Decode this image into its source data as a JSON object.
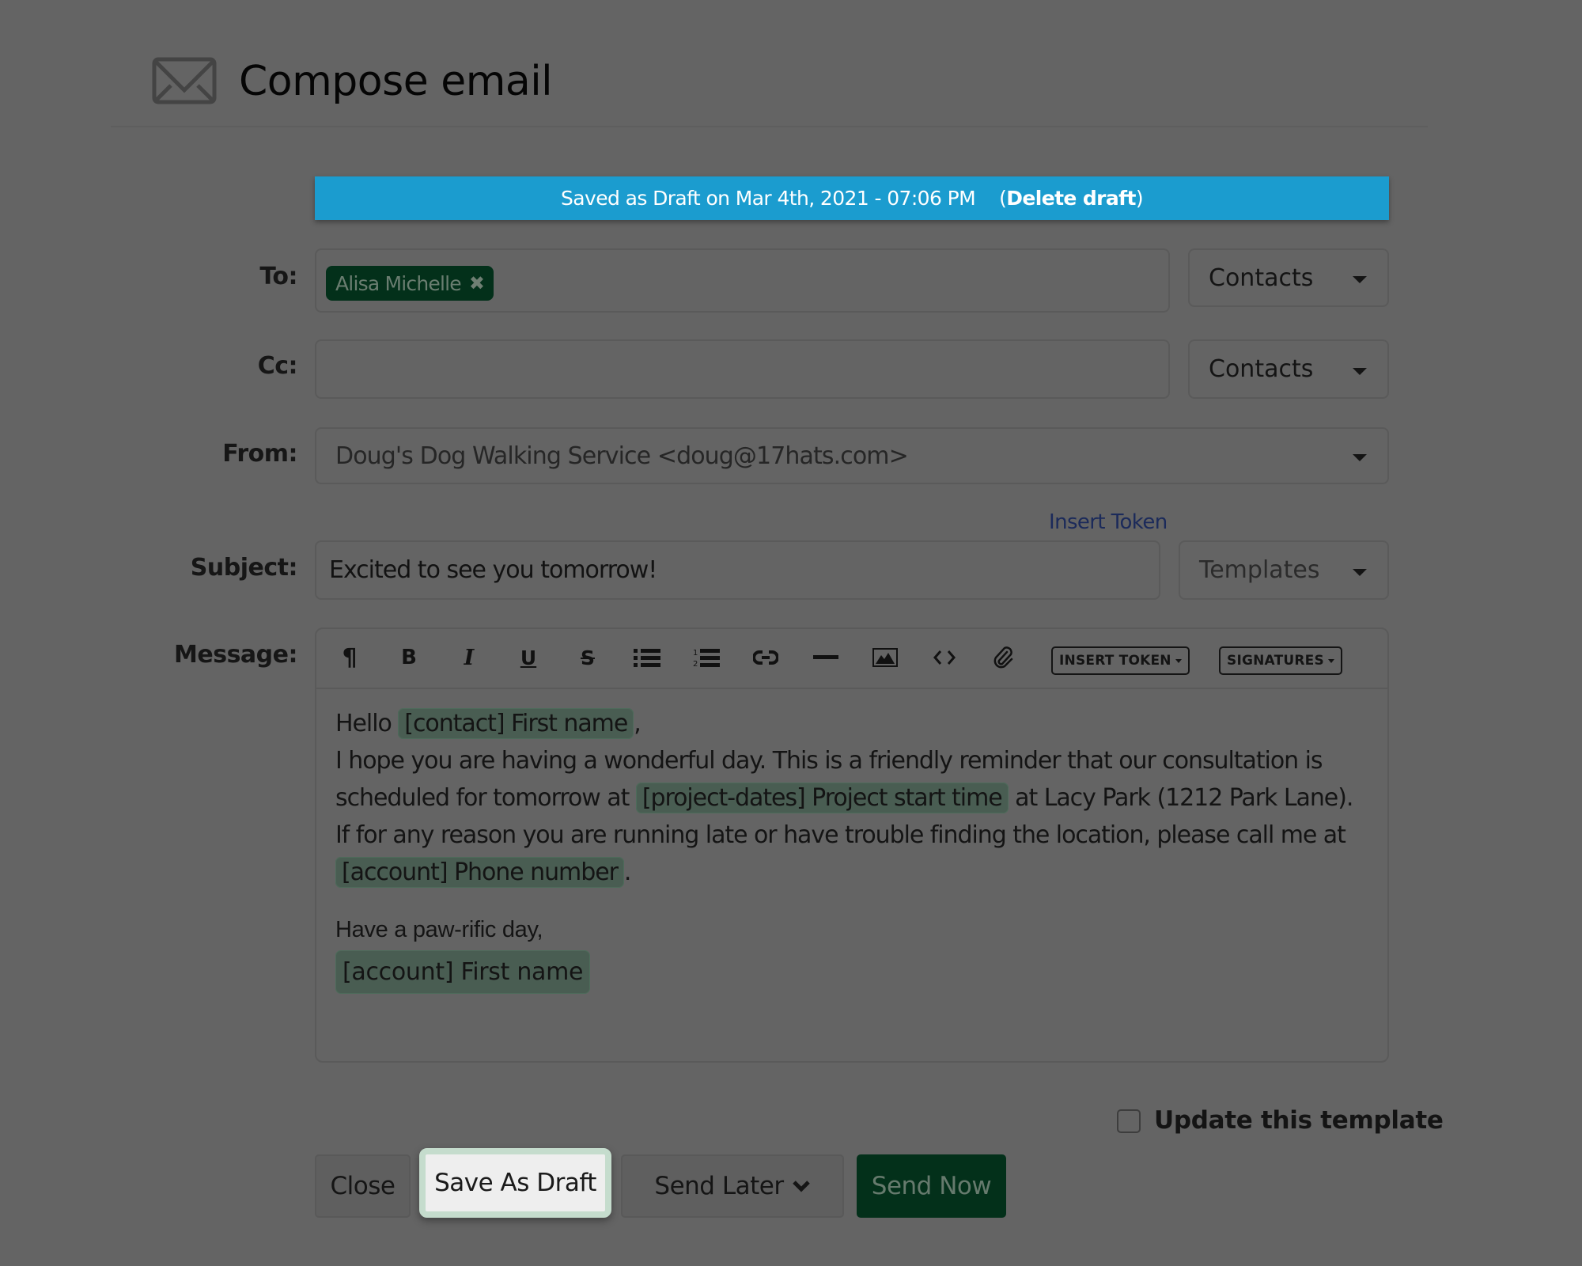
{
  "header": {
    "title": "Compose email",
    "icon": "envelope-icon"
  },
  "banner": {
    "text": "Saved as Draft on Mar 4th, 2021 - 07:06 PM",
    "open_paren": "(",
    "delete_link": "Delete draft",
    "close_paren": ")",
    "color": "#1b9ccf"
  },
  "to": {
    "label": "To:",
    "recipients": [
      {
        "name": "Alisa Michelle",
        "remove_icon": "close-icon"
      }
    ],
    "dropdown": "Contacts"
  },
  "cc": {
    "label": "Cc:",
    "value": "",
    "dropdown": "Contacts"
  },
  "from": {
    "label": "From:",
    "value": "Doug's Dog Walking Service <doug@17hats.com>"
  },
  "subject": {
    "label": "Subject:",
    "insert_token_link": "Insert Token",
    "value": "Excited to see you tomorrow!",
    "dropdown": "Templates"
  },
  "message": {
    "label": "Message:",
    "toolbar": {
      "buttons": [
        {
          "name": "paragraph",
          "icon": "paragraph-icon",
          "glyph": "¶"
        },
        {
          "name": "bold",
          "icon": "bold-icon",
          "glyph": "B"
        },
        {
          "name": "italic",
          "icon": "italic-icon",
          "glyph": "I"
        },
        {
          "name": "underline",
          "icon": "underline-icon",
          "glyph": "U"
        },
        {
          "name": "strikethrough",
          "icon": "strikethrough-icon",
          "glyph": "S"
        },
        {
          "name": "bullet-list",
          "icon": "bullet-list-icon"
        },
        {
          "name": "numbered-list",
          "icon": "numbered-list-icon"
        },
        {
          "name": "link",
          "icon": "link-icon"
        },
        {
          "name": "horizontal-rule",
          "icon": "horizontal-rule-icon"
        },
        {
          "name": "image",
          "icon": "image-icon"
        },
        {
          "name": "code",
          "icon": "code-icon"
        },
        {
          "name": "attachment",
          "icon": "paperclip-icon"
        }
      ],
      "insert_token": "INSERT TOKEN",
      "signatures": "SIGNATURES"
    },
    "body": {
      "greeting": "Hello",
      "token_contact_first_name": "[contact] First name",
      "comma": ",",
      "line2a": "I hope you are having a wonderful day. This is a friendly reminder that our consultation is scheduled for tomorrow at",
      "token_project_start": "[project-dates] Project start time",
      "line2b": "at Lacy Park (1212 Park Lane). If for any reason you are running late or have trouble finding the location, please call me at",
      "token_phone": "[account] Phone number",
      "period": ".",
      "signoff": "Have a paw-rific day,",
      "token_account_first_name": "[account] First name"
    }
  },
  "options": {
    "update_template_label": "Update this template",
    "update_template_checked": false
  },
  "actions": {
    "close": "Close",
    "save_draft": "Save As Draft",
    "send_later": "Send Later",
    "send_now": "Send Now",
    "send_now_color": "#03301a"
  }
}
